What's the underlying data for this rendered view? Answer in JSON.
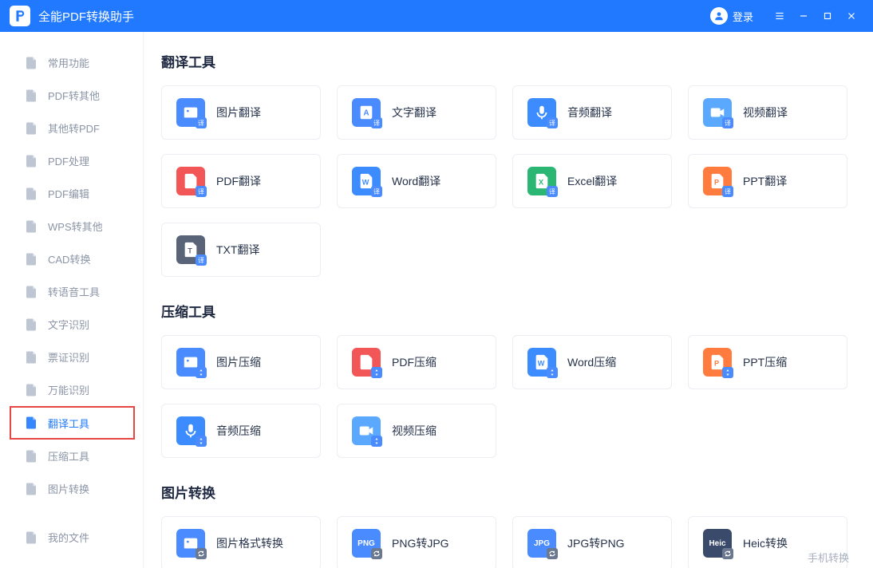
{
  "titlebar": {
    "app_title": "全能PDF转换助手",
    "login_label": "登录"
  },
  "sidebar": {
    "items": [
      {
        "label": "常用功能",
        "key": "common"
      },
      {
        "label": "PDF转其他",
        "key": "pdf-to"
      },
      {
        "label": "其他转PDF",
        "key": "to-pdf"
      },
      {
        "label": "PDF处理",
        "key": "pdf-process"
      },
      {
        "label": "PDF编辑",
        "key": "pdf-edit"
      },
      {
        "label": "WPS转其他",
        "key": "wps"
      },
      {
        "label": "CAD转换",
        "key": "cad"
      },
      {
        "label": "转语音工具",
        "key": "speech"
      },
      {
        "label": "文字识别",
        "key": "ocr"
      },
      {
        "label": "票证识别",
        "key": "ticket"
      },
      {
        "label": "万能识别",
        "key": "universal"
      },
      {
        "label": "翻译工具",
        "key": "translate",
        "active": true,
        "highlighted": true
      },
      {
        "label": "压缩工具",
        "key": "compress"
      },
      {
        "label": "图片转换",
        "key": "image-convert"
      }
    ],
    "bottom_item": {
      "label": "我的文件",
      "key": "my-files"
    }
  },
  "sections": [
    {
      "title": "翻译工具",
      "cards": [
        {
          "label": "图片翻译",
          "key": "image-translate",
          "icon": "image",
          "color": "ic-blue",
          "badge": "译"
        },
        {
          "label": "文字翻译",
          "key": "text-translate",
          "icon": "text",
          "color": "ic-blue",
          "badge": "A"
        },
        {
          "label": "音频翻译",
          "key": "audio-translate",
          "icon": "mic",
          "color": "ic-mic",
          "badge": "译"
        },
        {
          "label": "视频翻译",
          "key": "video-translate",
          "icon": "video",
          "color": "ic-video",
          "badge": "译"
        },
        {
          "label": "PDF翻译",
          "key": "pdf-translate",
          "icon": "pdf",
          "color": "ic-red",
          "badge": "译"
        },
        {
          "label": "Word翻译",
          "key": "word-translate",
          "icon": "word",
          "color": "ic-word",
          "badge": "译"
        },
        {
          "label": "Excel翻译",
          "key": "excel-translate",
          "icon": "excel",
          "color": "ic-green",
          "badge": "译"
        },
        {
          "label": "PPT翻译",
          "key": "ppt-translate",
          "icon": "ppt",
          "color": "ic-orange",
          "badge": "译"
        },
        {
          "label": "TXT翻译",
          "key": "txt-translate",
          "icon": "txt",
          "color": "ic-dark",
          "badge": "译"
        }
      ]
    },
    {
      "title": "压缩工具",
      "cards": [
        {
          "label": "图片压缩",
          "key": "image-compress",
          "icon": "image",
          "color": "ic-blue",
          "badge": "⇅"
        },
        {
          "label": "PDF压缩",
          "key": "pdf-compress",
          "icon": "pdf",
          "color": "ic-red",
          "badge": "⇅"
        },
        {
          "label": "Word压缩",
          "key": "word-compress",
          "icon": "word",
          "color": "ic-word",
          "badge": "⇅"
        },
        {
          "label": "PPT压缩",
          "key": "ppt-compress",
          "icon": "ppt",
          "color": "ic-orange",
          "badge": "⇅"
        },
        {
          "label": "音频压缩",
          "key": "audio-compress",
          "icon": "mic",
          "color": "ic-mic",
          "badge": "⇅"
        },
        {
          "label": "视频压缩",
          "key": "video-compress",
          "icon": "video",
          "color": "ic-video",
          "badge": "⇅"
        }
      ]
    },
    {
      "title": "图片转换",
      "cards": [
        {
          "label": "图片格式转换",
          "key": "image-format",
          "icon": "image",
          "color": "ic-blue",
          "badge": "↻"
        },
        {
          "label": "PNG转JPG",
          "key": "png-to-jpg",
          "icon": "PNG",
          "color": "ic-png",
          "badge": "↻",
          "textIcon": true
        },
        {
          "label": "JPG转PNG",
          "key": "jpg-to-png",
          "icon": "JPG",
          "color": "ic-jpg",
          "badge": "↻",
          "textIcon": true
        },
        {
          "label": "Heic转换",
          "key": "heic-convert",
          "icon": "Heic",
          "color": "ic-heic",
          "badge": "↻",
          "textIcon": true
        }
      ]
    }
  ],
  "footer_link": "手机转换"
}
